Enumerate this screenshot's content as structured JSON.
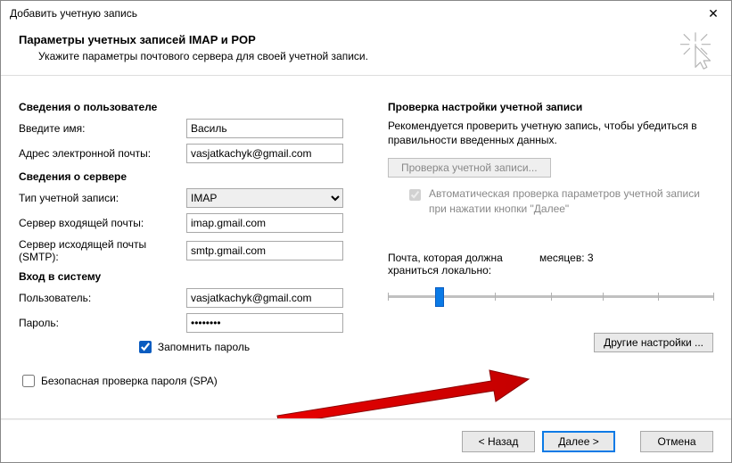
{
  "window": {
    "title": "Добавить учетную запись"
  },
  "header": {
    "title": "Параметры учетных записей IMAP и POP",
    "subtitle": "Укажите параметры почтового сервера для своей учетной записи."
  },
  "left": {
    "section_user": "Сведения о пользователе",
    "name_label": "Введите имя:",
    "name_value": "Василь",
    "email_label": "Адрес электронной почты:",
    "email_value": "vasjatkachyk@gmail.com",
    "section_server": "Сведения о сервере",
    "account_type_label": "Тип учетной записи:",
    "account_type_value": "IMAP",
    "incoming_label": "Сервер входящей почты:",
    "incoming_value": "imap.gmail.com",
    "outgoing_label": "Сервер исходящей почты (SMTP):",
    "outgoing_value": "smtp.gmail.com",
    "section_login": "Вход в систему",
    "user_label": "Пользователь:",
    "user_value": "vasjatkachyk@gmail.com",
    "password_label": "Пароль:",
    "password_value": "********",
    "remember_label": "Запомнить пароль",
    "remember_checked": true,
    "spa_label": "Безопасная проверка пароля (SPA)",
    "spa_checked": false
  },
  "right": {
    "section": "Проверка настройки учетной записи",
    "text": "Рекомендуется проверить учетную запись, чтобы убедиться в правильности введенных данных.",
    "test_button": "Проверка учетной записи...",
    "auto_test_checked": true,
    "auto_test_label": "Автоматическая проверка параметров учетной записи при нажатии кнопки \"Далее\"",
    "local_label_left": "Почта, которая должна храниться локально:",
    "local_label_right": "месяцев: 3",
    "more_button": "Другие настройки ..."
  },
  "footer": {
    "back": "< Назад",
    "next": "Далее >",
    "cancel": "Отмена"
  }
}
